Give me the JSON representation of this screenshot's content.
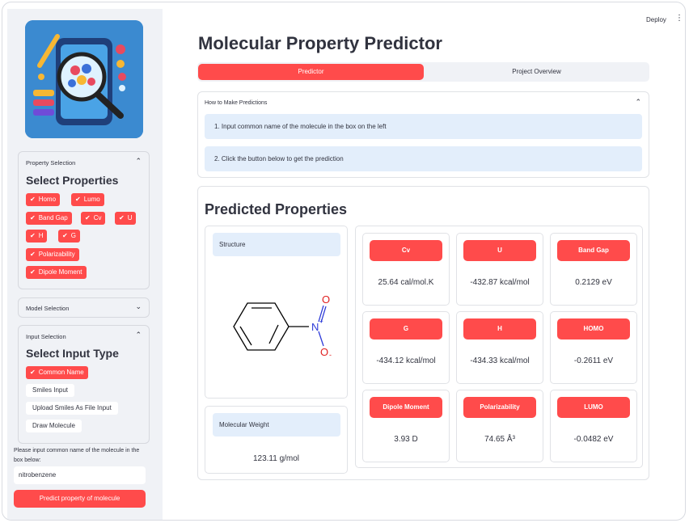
{
  "header": {
    "deploy_label": "Deploy",
    "menu_icon": "more-vertical-icon"
  },
  "app": {
    "title": "Molecular Property Predictor"
  },
  "tabs": [
    {
      "label": "Predictor",
      "active": true
    },
    {
      "label": "Project Overview",
      "active": false
    }
  ],
  "sidebar": {
    "property_selection": {
      "header": "Property Selection",
      "title": "Select Properties",
      "selected": [
        "Homo",
        "Lumo",
        "Band Gap",
        "Cv",
        "U",
        "H",
        "G",
        "Polarizability",
        "Dipole Moment"
      ]
    },
    "model_selection": {
      "header": "Model Selection"
    },
    "input_selection": {
      "header": "Input Selection",
      "title": "Select Input Type",
      "options": [
        "Common Name",
        "Smiles Input",
        "Upload Smiles As File Input",
        "Draw Molecule"
      ],
      "selected": "Common Name"
    },
    "hint": "Please input common name of the molecule in the box below:",
    "input_value": "nitrobenzene",
    "predict_button": "Predict property of molecule"
  },
  "instructions": {
    "title": "How to Make Predictions",
    "steps": [
      "1.   Input common name of the molecule in the box on the left",
      "2.   Click the button below to get the prediction"
    ]
  },
  "results": {
    "title": "Predicted Properties",
    "structure_label": "Structure",
    "molecular_weight_label": "Molecular Weight",
    "molecular_weight": "123.11 g/mol",
    "atom_labels": {
      "n": "N",
      "n_charge": "+",
      "o_top": "O",
      "o_bottom": "O",
      "o_charge": "-"
    },
    "properties": [
      {
        "name": "Cv",
        "value": "25.64 cal/mol.K"
      },
      {
        "name": "U",
        "value": "-432.87 kcal/mol"
      },
      {
        "name": "Band Gap",
        "value": "0.2129 eV"
      },
      {
        "name": "G",
        "value": "-434.12 kcal/mol"
      },
      {
        "name": "H",
        "value": "-434.33 kcal/mol"
      },
      {
        "name": "HOMO",
        "value": "-0.2611 eV"
      },
      {
        "name": "Dipole Moment",
        "value": "3.93 D"
      },
      {
        "name": "Polarizability",
        "value": "74.65 Å³"
      },
      {
        "name": "LUMO",
        "value": "-0.0482 eV"
      }
    ]
  },
  "colors": {
    "accent": "#ff4b4b",
    "info_bg": "#e3eefb",
    "sidebar_bg": "#f0f2f6",
    "text": "#31333f"
  }
}
